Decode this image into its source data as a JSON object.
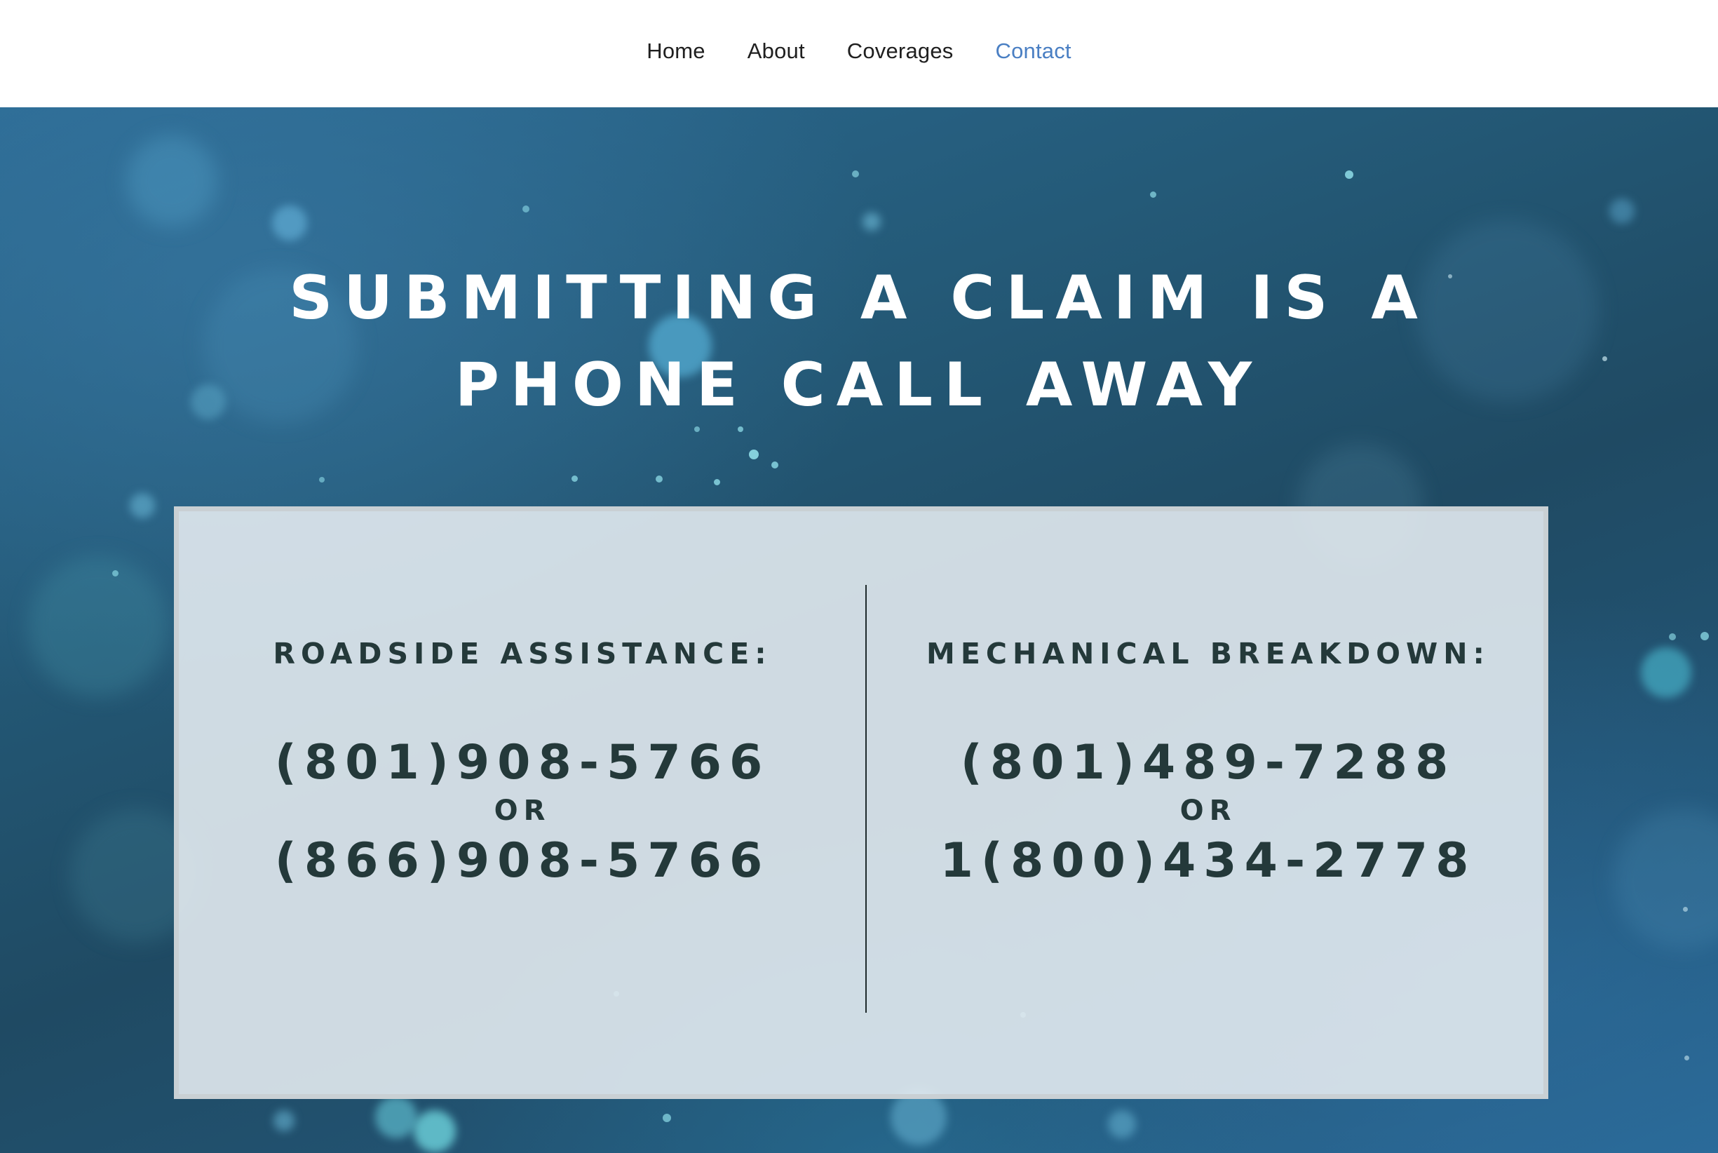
{
  "nav": {
    "items": [
      {
        "label": "Home",
        "active": false
      },
      {
        "label": "About",
        "active": false
      },
      {
        "label": "Coverages",
        "active": false
      },
      {
        "label": "Contact",
        "active": true
      }
    ],
    "active_color": "#4a7fc3"
  },
  "hero": {
    "title_line1": "SUBMITTING A CLAIM IS A",
    "title_line2": "PHONE CALL AWAY"
  },
  "contacts": {
    "roadside": {
      "heading": "ROADSIDE ASSISTANCE:",
      "phone_primary": "(801)908-5766",
      "separator": "OR",
      "phone_secondary": "(866)908-5766"
    },
    "mechanical": {
      "heading": "MECHANICAL BREAKDOWN:",
      "phone_primary": "(801)489-7288",
      "separator": "OR",
      "phone_secondary": "1(800)434-2778"
    }
  },
  "colors": {
    "text_dark": "#24393a",
    "card_background": "#e2eaef",
    "hero_blue": "#245a78"
  }
}
